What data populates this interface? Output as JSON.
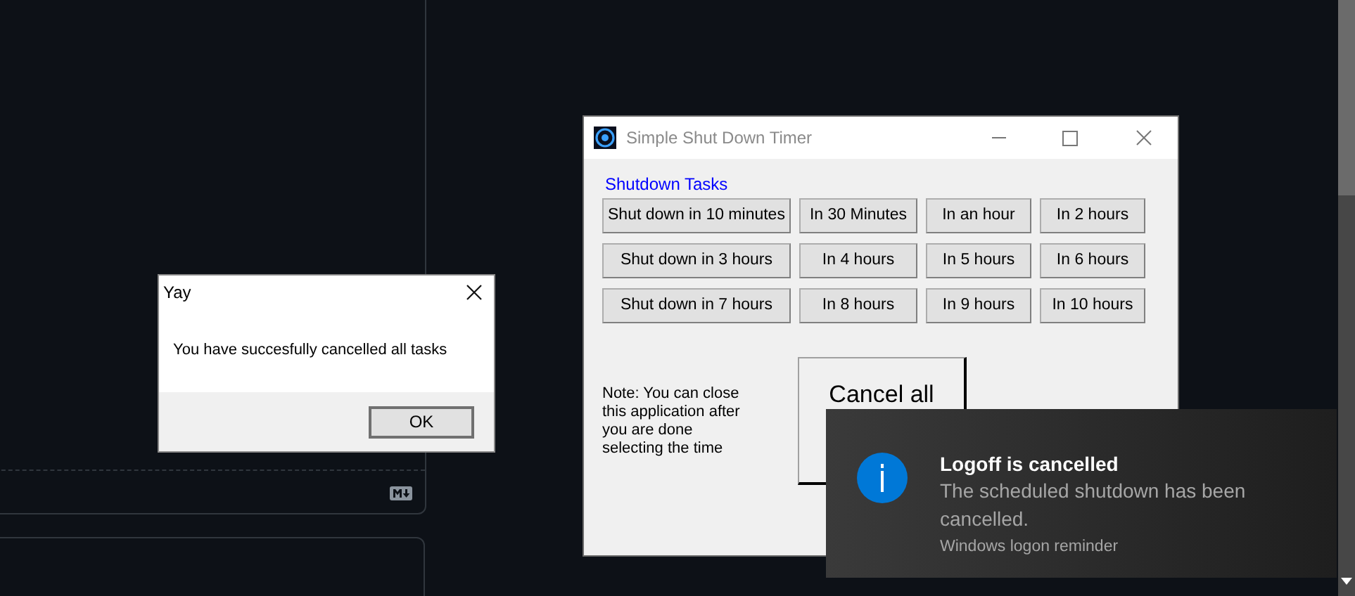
{
  "timer_window": {
    "title": "Simple Shut Down Timer",
    "group_label": "Shutdown Tasks",
    "task_buttons": [
      [
        "Shut down in 10 minutes",
        "In 30 Minutes",
        "In an hour",
        "In 2 hours"
      ],
      [
        "Shut down in 3 hours",
        "In 4 hours",
        "In 5 hours",
        "In 6 hours"
      ],
      [
        "Shut down in 7 hours",
        "In 8 hours",
        "In 9 hours",
        "In 10 hours"
      ]
    ],
    "note": [
      "Note: You can close",
      "this application after",
      "you are done",
      "selecting the time"
    ],
    "cancel_button": "Cancel all"
  },
  "message_box": {
    "title": "Yay",
    "message": "You have succesfully cancelled all tasks",
    "button": "OK"
  },
  "toast": {
    "title": "Logoff is cancelled",
    "body": "The scheduled shutdown has been cancelled.",
    "source": "Windows logon reminder"
  }
}
